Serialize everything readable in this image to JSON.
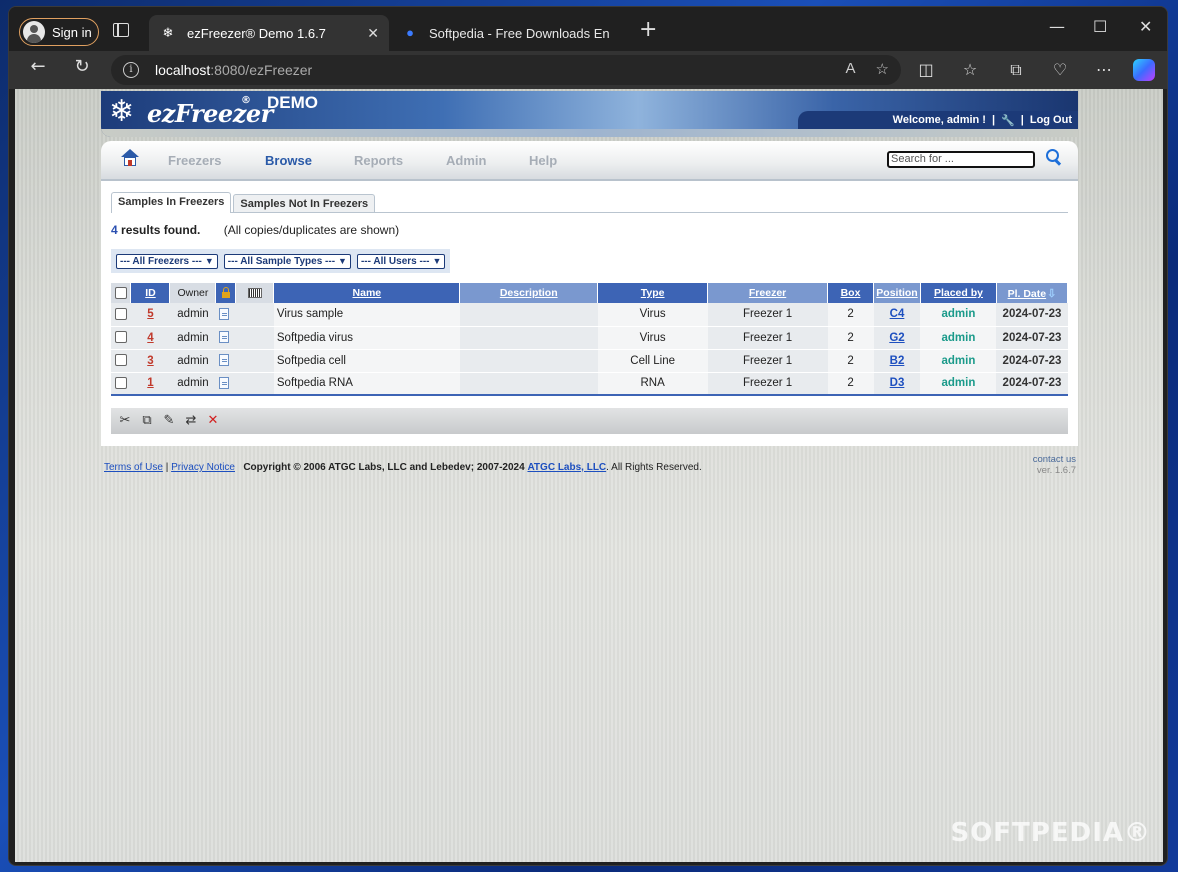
{
  "browser": {
    "signin_label": "Sign in",
    "tabs": [
      {
        "title": "ezFreezer® Demo 1.6.7",
        "favicon": "snowflake-icon",
        "active": true
      },
      {
        "title": "Softpedia - Free Downloads Ency",
        "favicon": "softpedia-icon",
        "active": false
      }
    ],
    "url_host": "localhost",
    "url_rest": ":8080/ezFreezer",
    "newtab": "+",
    "minimize": "—",
    "maximize": "☐",
    "close": "✕"
  },
  "header": {
    "logo_text": "ezFreezer",
    "logo_reg": "®",
    "demo": "DEMO",
    "welcome": "Welcome, admin !",
    "sep": "|",
    "logout": "Log Out"
  },
  "nav": {
    "items": [
      "Freezers",
      "Browse",
      "Reports",
      "Admin",
      "Help"
    ],
    "active": "Browse",
    "search_placeholder": "Search for ..."
  },
  "subtabs": [
    "Samples In Freezers",
    "Samples Not In Freezers"
  ],
  "results": {
    "count": "4",
    "found": " results found.",
    "note": "(All copies/duplicates are shown)"
  },
  "filters": [
    "--- All Freezers ---",
    "--- All Sample Types ---",
    "--- All Users ---"
  ],
  "table": {
    "headers": [
      "ID",
      "Owner",
      "",
      "",
      "Name",
      "Description",
      "Type",
      "Freezer",
      "Box",
      "Position",
      "Placed by",
      "Pl. Date"
    ],
    "rows": [
      {
        "id": "5",
        "owner": "admin",
        "name": "Virus sample",
        "description": "",
        "type": "Virus",
        "freezer": "Freezer 1",
        "box": "2",
        "position": "C4",
        "placed_by": "admin",
        "date": "2024-07-23"
      },
      {
        "id": "4",
        "owner": "admin",
        "name": "Softpedia virus",
        "description": "",
        "type": "Virus",
        "freezer": "Freezer 1",
        "box": "2",
        "position": "G2",
        "placed_by": "admin",
        "date": "2024-07-23"
      },
      {
        "id": "3",
        "owner": "admin",
        "name": "Softpedia cell",
        "description": "",
        "type": "Cell Line",
        "freezer": "Freezer 1",
        "box": "2",
        "position": "B2",
        "placed_by": "admin",
        "date": "2024-07-23"
      },
      {
        "id": "1",
        "owner": "admin",
        "name": "Softpedia RNA",
        "description": "",
        "type": "RNA",
        "freezer": "Freezer 1",
        "box": "2",
        "position": "D3",
        "placed_by": "admin",
        "date": "2024-07-23"
      }
    ]
  },
  "footer": {
    "terms": "Terms of Use",
    "sep": "|",
    "privacy": "Privacy Notice",
    "copyright": "Copyright © 2006 ATGC Labs, LLC and Lebedev;  2007-2024",
    "company": "ATGC Labs, LLC",
    "rights": ".   All Rights Reserved.",
    "contact": "contact us",
    "version": "ver. 1.6.7"
  },
  "watermark": "SOFTPEDIA®"
}
